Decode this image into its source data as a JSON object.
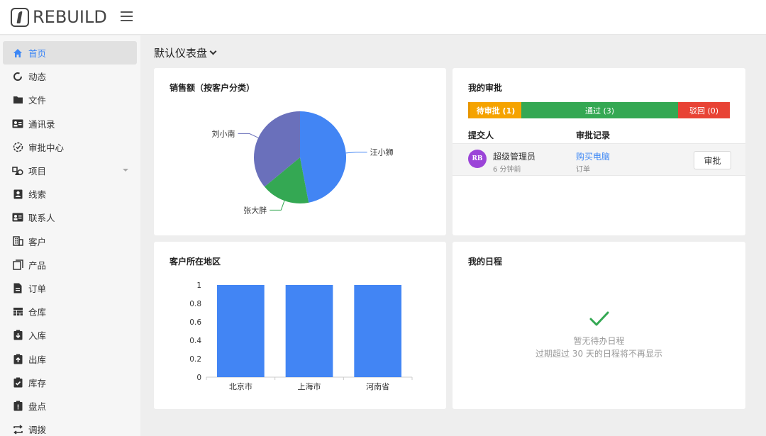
{
  "header": {
    "logo_text": "REBUILD"
  },
  "sidebar": {
    "items": [
      {
        "label": "首页",
        "icon": "home-icon",
        "active": true
      },
      {
        "label": "动态",
        "icon": "activity-ring-icon"
      },
      {
        "label": "文件",
        "icon": "folder-icon"
      },
      {
        "label": "通讯录",
        "icon": "contact-card-icon"
      },
      {
        "label": "审批中心",
        "icon": "approval-clock-icon"
      },
      {
        "label": "项目",
        "icon": "project-shapes-icon",
        "expandable": true
      },
      {
        "label": "线索",
        "icon": "lead-user-icon"
      },
      {
        "label": "联系人",
        "icon": "contacts-card-icon"
      },
      {
        "label": "客户",
        "icon": "building-icon"
      },
      {
        "label": "产品",
        "icon": "product-copy-icon"
      },
      {
        "label": "订单",
        "icon": "document-icon"
      },
      {
        "label": "仓库",
        "icon": "warehouse-icon"
      },
      {
        "label": "入库",
        "icon": "inbound-clipboard-icon"
      },
      {
        "label": "出库",
        "icon": "outbound-clipboard-icon"
      },
      {
        "label": "库存",
        "icon": "inventory-check-icon"
      },
      {
        "label": "盘点",
        "icon": "stocktake-clipboard-icon"
      },
      {
        "label": "调拨",
        "icon": "transfer-arrows-icon"
      }
    ]
  },
  "main": {
    "title": "默认仪表盘"
  },
  "sales_card": {
    "title": "销售额（按客户分类）"
  },
  "approval_card": {
    "title": "我的审批",
    "status": {
      "pending": "待审批 (1)",
      "passed": "通过 (3)",
      "rejected": "驳回 (0)"
    },
    "columns": {
      "submitter": "提交人",
      "record": "审批记录"
    },
    "row": {
      "avatar_initials": "RB",
      "submitter": "超级管理员",
      "time": "6 分钟前",
      "record": "购买电脑",
      "record_type": "订单",
      "action": "审批"
    }
  },
  "region_card": {
    "title": "客户所在地区"
  },
  "schedule_card": {
    "title": "我的日程",
    "empty_title": "暂无待办日程",
    "empty_hint": "过期超过 30 天的日程将不再显示"
  },
  "colors": {
    "accent": "#3d87f5",
    "pending": "#f5a300",
    "passed": "#34a853",
    "rejected": "#e84335",
    "pie_blue": "#4285f4",
    "pie_green": "#34a853",
    "pie_purple": "#6a70bb"
  },
  "chart_data": [
    {
      "type": "pie",
      "title": "销售额（按客户分类）",
      "slices": [
        {
          "label": "汪小狮",
          "value": 47,
          "color": "#4285f4"
        },
        {
          "label": "张大胖",
          "value": 17,
          "color": "#34a853"
        },
        {
          "label": "刘小南",
          "value": 36,
          "color": "#6a70bb"
        }
      ]
    },
    {
      "type": "bar",
      "title": "客户所在地区",
      "categories": [
        "北京市",
        "上海市",
        "河南省"
      ],
      "values": [
        1,
        1,
        1
      ],
      "ylim": [
        0,
        1
      ],
      "yticks": [
        "0",
        "0.2",
        "0.4",
        "0.6",
        "0.8",
        "1"
      ],
      "color": "#4285f4"
    }
  ]
}
